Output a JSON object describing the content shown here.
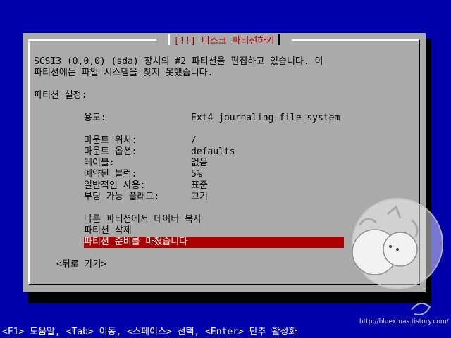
{
  "dialog": {
    "title": "[!!] 디스크 파티션하기",
    "intro_line1": "SCSI3 (0,0,0) (sda) 장치의 #2 파티션을 편집하고 있습니다. 이",
    "intro_line2": "파티션에는 파일 시스템을 찾지 못했습니다.",
    "section_label": "파티션 설정:",
    "settings": [
      {
        "label": "용도:",
        "value": "Ext4 journaling file system"
      },
      {
        "label": "마운트 위치:",
        "value": "/"
      },
      {
        "label": "마운트 옵션:",
        "value": "defaults"
      },
      {
        "label": "레이블:",
        "value": "없음"
      },
      {
        "label": "예약된 블럭:",
        "value": "5%"
      },
      {
        "label": "일반적인 사용:",
        "value": "표준"
      },
      {
        "label": "부팅 가능 플래그:",
        "value": "끄기"
      }
    ],
    "actions": [
      {
        "label": "다른 파티션에서 데이터 복사"
      },
      {
        "label": "파티션 삭제"
      },
      {
        "label": "파티션 준비를 마쳤습니다"
      }
    ],
    "back_button": "<뒤로 가기>"
  },
  "help_bar": "<F1> 도움말, <Tab> 이동, <스페이스> 선택, <Enter> 단추 활성화",
  "watermark": {
    "url": "http://bluexmas.tistory.com/"
  },
  "colors": {
    "background": "#0000aa",
    "dialog": "#aaaaaa",
    "title": "#aa0000",
    "selection": "#aa0000",
    "selection_text": "#ffffff"
  }
}
